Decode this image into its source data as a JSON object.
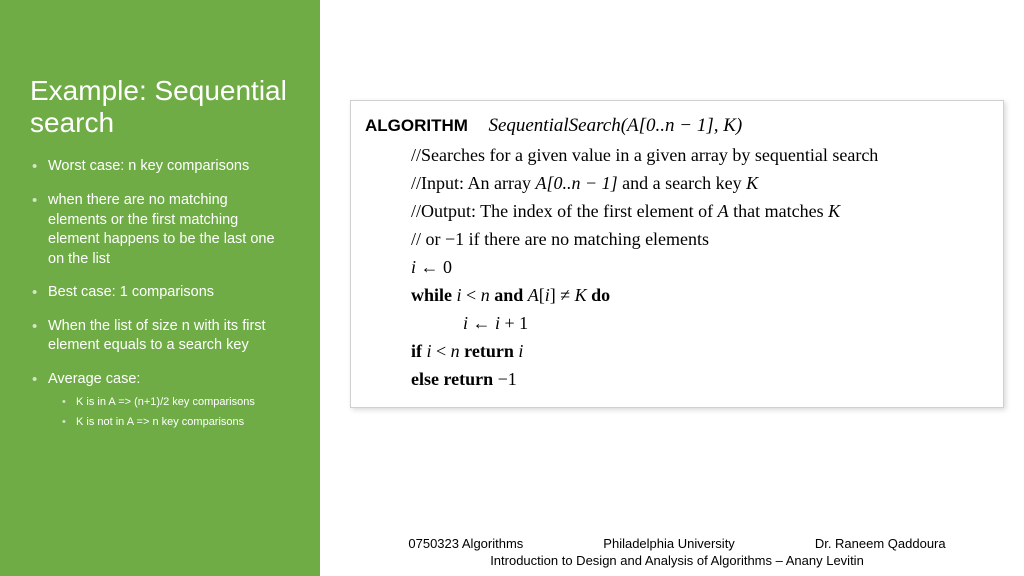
{
  "sidebar": {
    "title": "Example: Sequential search",
    "bullets": [
      {
        "text": "Worst case:  n key comparisons"
      },
      {
        "text": "when there are no matching elements or the first matching element happens to be the last one on the list"
      },
      {
        "text": "Best case:  1 comparisons"
      },
      {
        "text": "When the list of size n with its first element equals to a search key"
      },
      {
        "text": "Average case:",
        "sub": [
          "K is in A => (n+1)/2 key comparisons",
          "K is not in A => n key comparisons"
        ]
      }
    ]
  },
  "algorithm": {
    "keyword": "ALGORITHM",
    "signature": "SequentialSearch(A[0..n − 1], K)",
    "lines": {
      "c1": "//Searches for a given value in a given array by sequential search",
      "c2a": "//Input: An array ",
      "c2b": "A[0..n − 1]",
      "c2c": " and a search key ",
      "c2d": "K",
      "c3a": "//Output: The index of the first element of ",
      "c3b": "A",
      "c3c": " that matches ",
      "c3d": "K",
      "c4": "//             or −1 if there are no matching elements",
      "l1a": "i",
      "l1b": " ← 0",
      "l2_while": "while ",
      "l2_cond1a": "i",
      "l2_cond1b": " < ",
      "l2_cond1c": "n",
      "l2_and": " and ",
      "l2_cond2a": "A",
      "l2_cond2b": "[",
      "l2_cond2c": "i",
      "l2_cond2d": "] ≠ ",
      "l2_cond2e": "K",
      "l2_do": " do",
      "l3a": "i",
      "l3b": " ← ",
      "l3c": "i",
      "l3d": " + 1",
      "l4_if": "if ",
      "l4a": "i",
      "l4b": " < ",
      "l4c": "n",
      "l4_ret": " return ",
      "l4d": "i",
      "l5_else": "else return ",
      "l5a": "−1"
    }
  },
  "footer": {
    "course": "0750323 Algorithms",
    "university": "Philadelphia University",
    "instructor": "Dr. Raneem Qaddoura",
    "book": "Introduction to Design and Analysis of Algorithms – Anany Levitin"
  }
}
